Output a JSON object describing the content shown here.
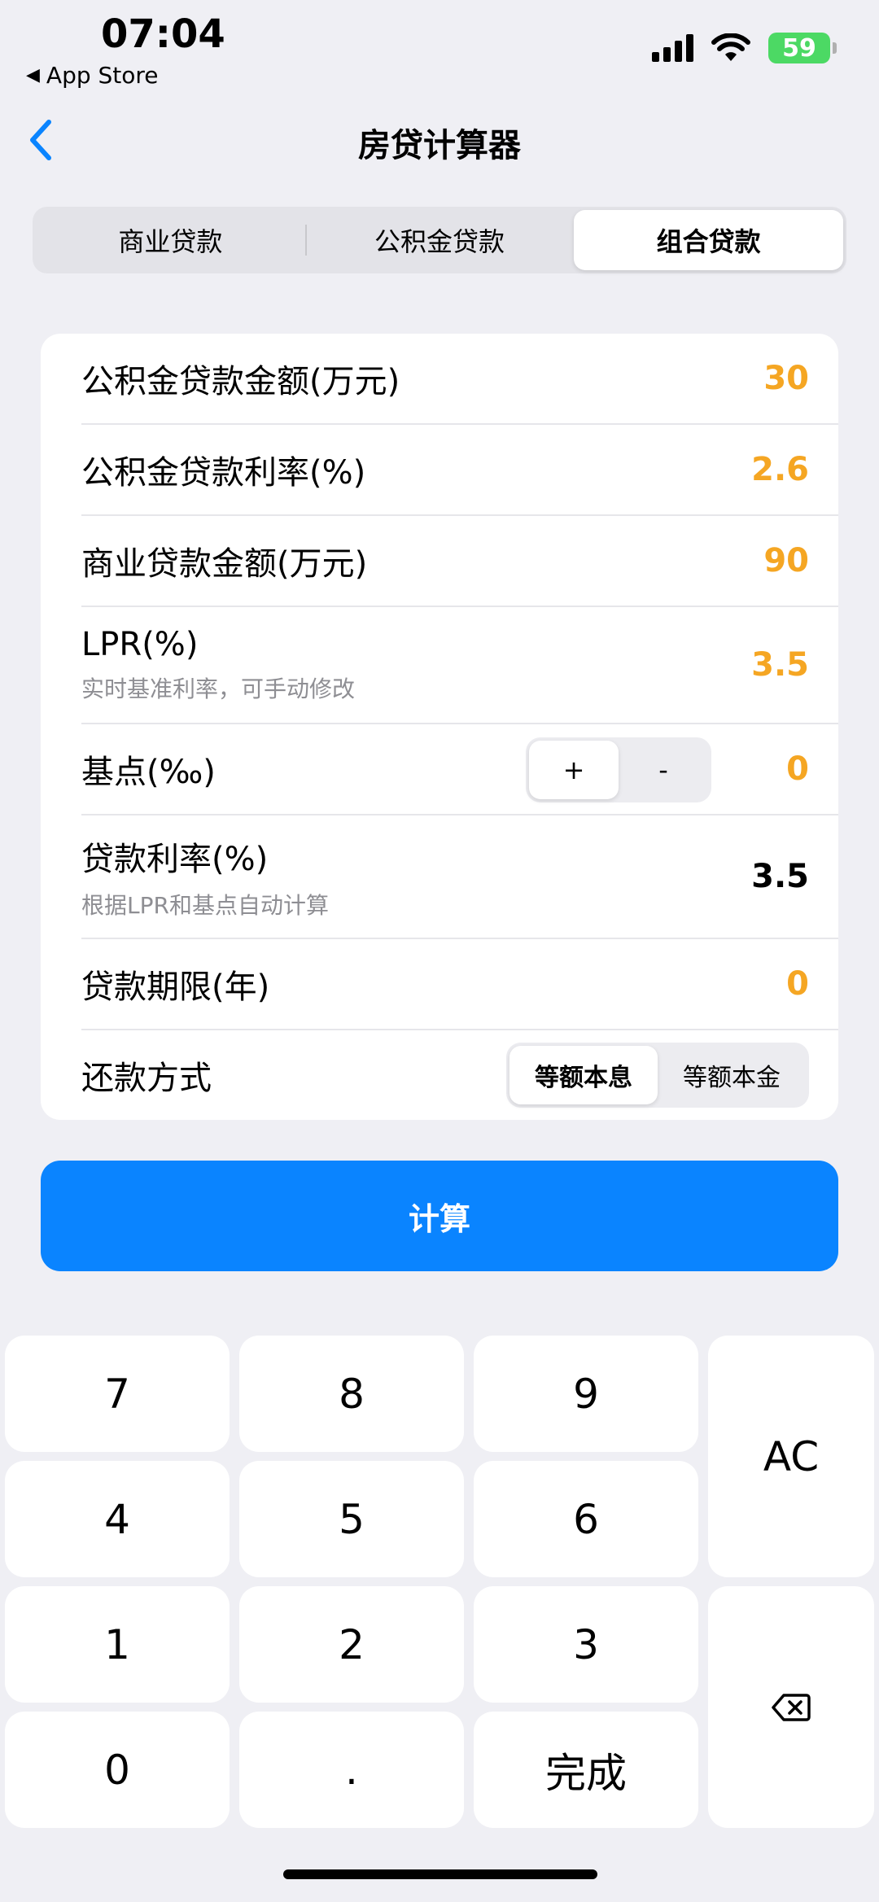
{
  "status_bar": {
    "time": "07:04",
    "back_app": "App Store",
    "battery": "59"
  },
  "nav": {
    "title": "房贷计算器"
  },
  "tabs": [
    {
      "label": "商业贷款"
    },
    {
      "label": "公积金贷款"
    },
    {
      "label": "组合贷款",
      "active": true
    }
  ],
  "form": {
    "fund_amount": {
      "label": "公积金贷款金额(万元)",
      "value": "30"
    },
    "fund_rate": {
      "label": "公积金贷款利率(%)",
      "value": "2.6"
    },
    "commercial_amount": {
      "label": "商业贷款金额(万元)",
      "value": "90"
    },
    "lpr": {
      "label": "LPR(%)",
      "sub": "实时基准利率，可手动修改",
      "value": "3.5"
    },
    "basis": {
      "label": "基点(‰)",
      "plus": "+",
      "minus": "-",
      "value": "0"
    },
    "loan_rate": {
      "label": "贷款利率(%)",
      "sub": "根据LPR和基点自动计算",
      "value": "3.5"
    },
    "term": {
      "label": "贷款期限(年)",
      "value": "0"
    },
    "repayment": {
      "label": "还款方式",
      "options": [
        "等额本息",
        "等额本金"
      ],
      "selected": "等额本息"
    }
  },
  "calculate_label": "计算",
  "keypad": {
    "k7": "7",
    "k8": "8",
    "k9": "9",
    "ac": "AC",
    "k4": "4",
    "k5": "5",
    "k6": "6",
    "k1": "1",
    "k2": "2",
    "k3": "3",
    "k0": "0",
    "dot": ".",
    "done": "完成"
  },
  "colors": {
    "accent": "#0a84ff",
    "value": "#f5a623",
    "battery": "#4cd964"
  },
  "icons": {
    "back": "chevron-left-icon",
    "delete": "delete-left-icon",
    "wifi": "wifi-icon",
    "signal": "signal-icon"
  }
}
